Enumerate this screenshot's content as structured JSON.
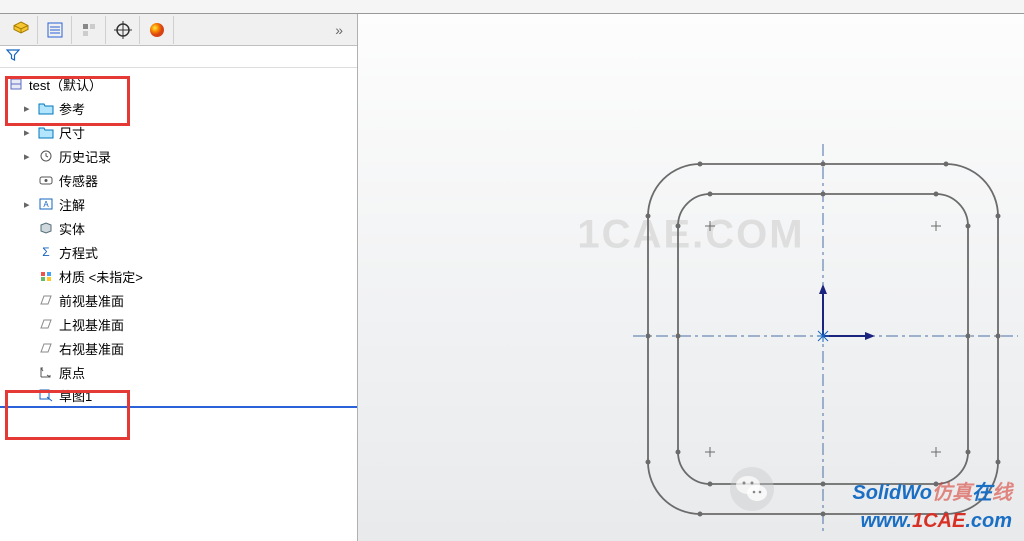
{
  "panel": {
    "expand_symbol": "»"
  },
  "tree": {
    "root": "test（默认）",
    "items": [
      {
        "label": "参考",
        "icon": "folder"
      },
      {
        "label": "尺寸",
        "icon": "folder"
      },
      {
        "label": "历史记录",
        "icon": "history"
      },
      {
        "label": "传感器",
        "icon": "sensor"
      },
      {
        "label": "注解",
        "icon": "annotation"
      },
      {
        "label": "实体",
        "icon": "body"
      },
      {
        "label": "方程式",
        "icon": "equation"
      },
      {
        "label": "材质 <未指定>",
        "icon": "material"
      },
      {
        "label": "前视基准面",
        "icon": "plane"
      },
      {
        "label": "上视基准面",
        "icon": "plane"
      },
      {
        "label": "右视基准面",
        "icon": "plane"
      },
      {
        "label": "原点",
        "icon": "origin"
      },
      {
        "label": "草图1",
        "icon": "sketch"
      }
    ]
  },
  "watermark": {
    "center": "1CAE.COM",
    "bottom_blue": "SolidWo",
    "bottom_red1": "仿真",
    "bottom_blue2": "在",
    "bottom_red2": "线",
    "url_blue": "www.",
    "url_red": "1CAE",
    "url_blue2": ".com"
  }
}
